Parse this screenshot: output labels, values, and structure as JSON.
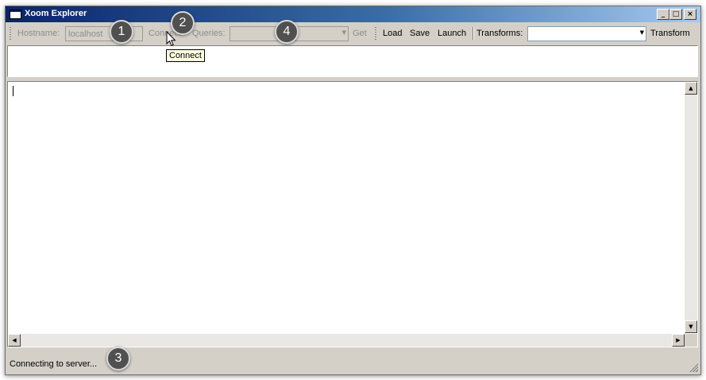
{
  "window": {
    "title": "Xoom Explorer",
    "controls": {
      "minimize": "_",
      "maximize": "□",
      "close": "×"
    }
  },
  "toolbar": {
    "hostname_label": "Hostname:",
    "hostname_value": "localhost",
    "connect_label": "Connect",
    "queries_label": "Queries:",
    "queries_value": "",
    "get_label": "Get",
    "load_label": "Load",
    "save_label": "Save",
    "launch_label": "Launch",
    "transforms_label": "Transforms:",
    "transforms_value": "",
    "transform_label": "Transform"
  },
  "tooltip": {
    "text": "Connect"
  },
  "status": {
    "text": "Connecting to server..."
  },
  "callouts": [
    "1",
    "2",
    "3",
    "4"
  ],
  "colors": {
    "titlebar_start": "#0a246a",
    "titlebar_end": "#a6caf0",
    "window_face": "#d4d0c8",
    "disabled_text": "#8c8c8c",
    "tooltip_bg": "#ffffe1",
    "callout_bg": "#505050"
  },
  "icons": [
    "app-window-icon",
    "mouse-pointer-icon",
    "dropdown-arrow-icon",
    "scroll-arrow-icon",
    "resize-grip-icon"
  ]
}
